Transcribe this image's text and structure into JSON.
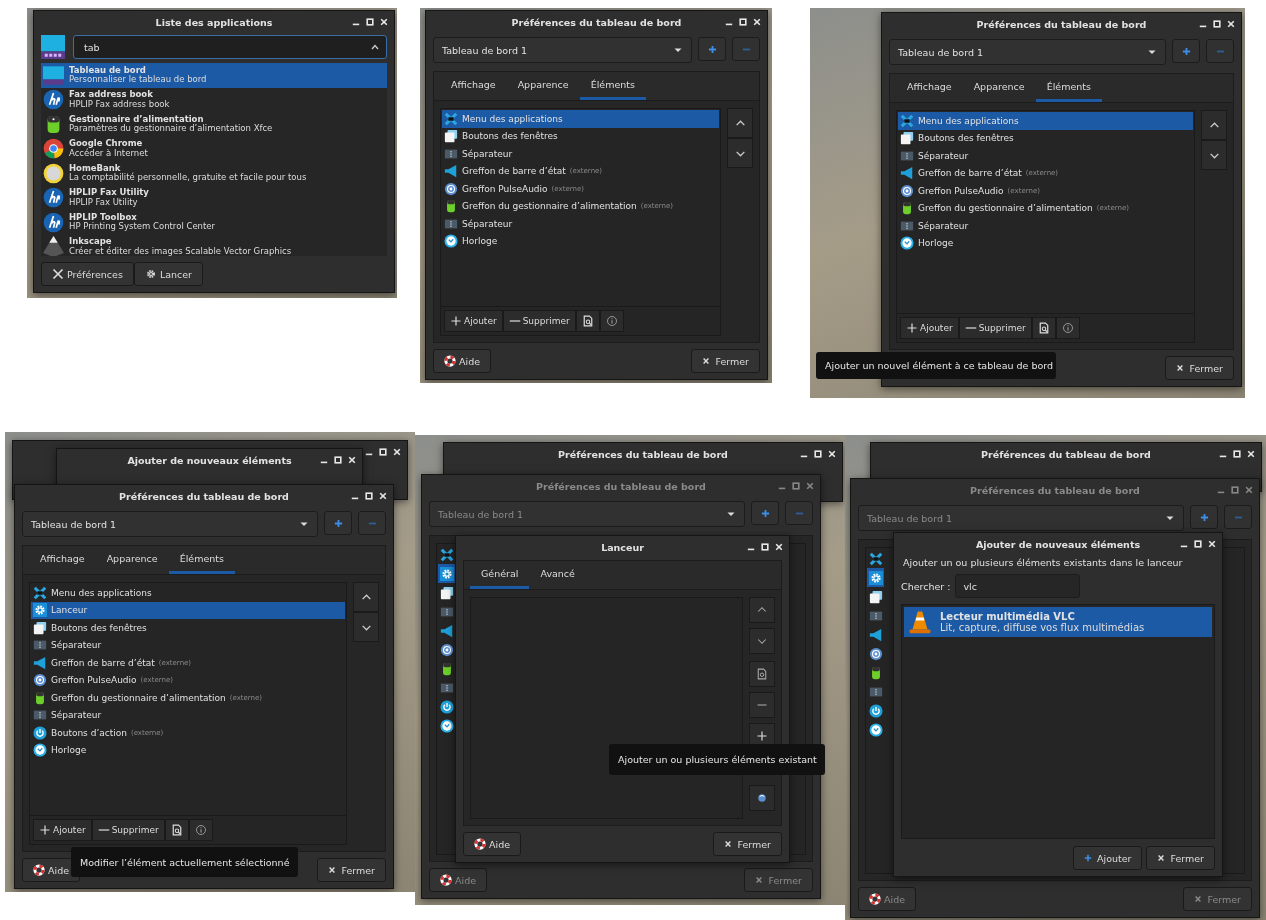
{
  "panels": [
    {
      "windows": [
        {
          "kind": "app_list",
          "title": "Liste des applications",
          "search": "tab",
          "apps": [
            {
              "name": "Tableau de bord",
              "description": "Personnaliser le tableau de bord",
              "selected": true
            },
            {
              "name": "Fax address book",
              "description": "HPLIP Fax address book",
              "selected": false
            },
            {
              "name": "Gestionnaire d’alimentation",
              "description": "Paramètres du gestionnaire d’alimentation Xfce",
              "selected": false
            },
            {
              "name": "Google Chrome",
              "description": "Accéder à Internet",
              "selected": false
            },
            {
              "name": "HomeBank",
              "description": "La comptabilité personnelle, gratuite et facile pour tous",
              "selected": false
            },
            {
              "name": "HPLIP Fax Utility",
              "description": "HPLIP Fax Utility",
              "selected": false
            },
            {
              "name": "HPLIP Toolbox",
              "description": "HP Printing System Control Center",
              "selected": false
            },
            {
              "name": "Inkscape",
              "description": "Créer et éditer des images Scalable Vector Graphics",
              "selected": false
            }
          ],
          "buttons": [
            "Préférences",
            "Lancer"
          ]
        }
      ]
    },
    {
      "windows": [
        {
          "kind": "prefs",
          "dimmed": false,
          "title": "Préférences du tableau de bord",
          "panel_name": "Tableau de bord 1",
          "tabs": [
            {
              "label": "Affichage",
              "selected": false
            },
            {
              "label": "Apparence",
              "selected": false
            },
            {
              "label": "Éléments",
              "selected": true
            }
          ],
          "items": [
            {
              "label": "Menu des applications",
              "selected": true
            },
            {
              "label": "Boutons des fenêtres",
              "selected": false
            },
            {
              "label": "Séparateur",
              "selected": false
            },
            {
              "label": "Greffon de barre d’état",
              "note": "(externe)",
              "selected": false
            },
            {
              "label": "Greffon PulseAudio",
              "note": "(externe)",
              "selected": false
            },
            {
              "label": "Greffon du gestionnaire d’alimentation",
              "note": "(externe)",
              "selected": false
            },
            {
              "label": "Séparateur",
              "selected": false
            },
            {
              "label": "Horloge",
              "selected": false
            }
          ],
          "toolbar": [
            "Ajouter",
            "Supprimer"
          ],
          "help": "Aide",
          "close": "Fermer"
        }
      ]
    },
    {
      "windows": [
        {
          "kind": "prefs",
          "dimmed": false,
          "title": "Préférences du tableau de bord",
          "panel_name": "Tableau de bord 1",
          "tabs": [
            {
              "label": "Affichage",
              "selected": false
            },
            {
              "label": "Apparence",
              "selected": false
            },
            {
              "label": "Éléments",
              "selected": true
            }
          ],
          "items": [
            {
              "label": "Menu des applications",
              "selected": true
            },
            {
              "label": "Boutons des fenêtres",
              "selected": false
            },
            {
              "label": "Séparateur",
              "selected": false
            },
            {
              "label": "Greffon de barre d’état",
              "note": "(externe)",
              "selected": false
            },
            {
              "label": "Greffon PulseAudio",
              "note": "(externe)",
              "selected": false
            },
            {
              "label": "Greffon du gestionnaire d’alimentation",
              "note": "(externe)",
              "selected": false
            },
            {
              "label": "Séparateur",
              "selected": false
            },
            {
              "label": "Horloge",
              "selected": false
            }
          ],
          "toolbar": [
            "Ajouter",
            "Supprimer"
          ],
          "close": "Fermer"
        }
      ],
      "tooltip": "Ajouter un nouvel élément à ce tableau de bord"
    },
    {
      "windows": [
        {
          "kind": "titlebar"
        },
        {
          "kind": "titlebar",
          "title": "Ajouter de nouveaux éléments"
        },
        {
          "kind": "prefs",
          "dimmed": false,
          "title": "Préférences du tableau de bord",
          "panel_name": "Tableau de bord 1",
          "tabs": [
            {
              "label": "Affichage",
              "selected": false
            },
            {
              "label": "Apparence",
              "selected": false
            },
            {
              "label": "Éléments",
              "selected": true
            }
          ],
          "items": [
            {
              "label": "Menu des applications",
              "selected": false
            },
            {
              "label": "Lanceur",
              "selected": true
            },
            {
              "label": "Boutons des fenêtres",
              "selected": false
            },
            {
              "label": "Séparateur",
              "selected": false
            },
            {
              "label": "Greffon de barre d’état",
              "note": "(externe)",
              "selected": false
            },
            {
              "label": "Greffon PulseAudio",
              "note": "(externe)",
              "selected": false
            },
            {
              "label": "Greffon du gestionnaire d’alimentation",
              "note": "(externe)",
              "selected": false
            },
            {
              "label": "Séparateur",
              "selected": false
            },
            {
              "label": "Boutons d’action",
              "note": "(externe)",
              "selected": false
            },
            {
              "label": "Horloge",
              "selected": false
            }
          ],
          "toolbar": [
            "Ajouter",
            "Supprimer"
          ],
          "help": "Aide",
          "close": "Fermer"
        }
      ],
      "tooltip": "Modifier l’élément actuellement sélectionné"
    },
    {
      "windows": [
        {
          "kind": "titlebar",
          "title": "Préférences du tableau de bord"
        },
        {
          "kind": "prefs",
          "dimmed": true,
          "title": "Préférences du tableau de bord",
          "panel_name": "Tableau de bord 1",
          "items": [
            {
              "selected": false
            },
            {
              "selected": true
            },
            {
              "selected": false
            },
            {
              "selected": false
            },
            {
              "selected": false
            },
            {
              "selected": false
            },
            {
              "selected": false
            },
            {
              "selected": false
            },
            {
              "selected": false
            },
            {
              "selected": false
            }
          ],
          "help": "Aide",
          "close": "Fermer"
        },
        {
          "kind": "launcher",
          "title": "Lanceur",
          "tabs": [
            {
              "label": "Général",
              "selected": true
            },
            {
              "label": "Avancé",
              "selected": false
            }
          ],
          "help": "Aide",
          "close": "Fermer"
        }
      ],
      "tooltip": "Ajouter un ou plusieurs éléments existant"
    },
    {
      "windows": [
        {
          "kind": "titlebar",
          "title": "Préférences du tableau de bord"
        },
        {
          "kind": "prefs",
          "dimmed": true,
          "title": "Préférences du tableau de bord",
          "panel_name": "Tableau de bord 1",
          "items": [
            {
              "selected": false
            },
            {
              "selected": true
            },
            {
              "selected": false
            },
            {
              "selected": false
            },
            {
              "selected": false
            },
            {
              "selected": false
            },
            {
              "selected": false
            },
            {
              "selected": false
            },
            {
              "selected": false
            },
            {
              "selected": false
            }
          ],
          "help": "Aide",
          "close": "Fermer"
        },
        {
          "kind": "add_items",
          "title": "Ajouter de nouveaux éléments",
          "description": "Ajouter un ou plusieurs éléments existants dans le lanceur",
          "search_label": "Chercher :",
          "search": "vlc",
          "results": [
            {
              "name": "Lecteur multimédia VLC",
              "description": "Lit, capture, diffuse vos flux multimédias",
              "selected": true
            }
          ],
          "add": "Ajouter",
          "close": "Fermer"
        }
      ]
    }
  ]
}
